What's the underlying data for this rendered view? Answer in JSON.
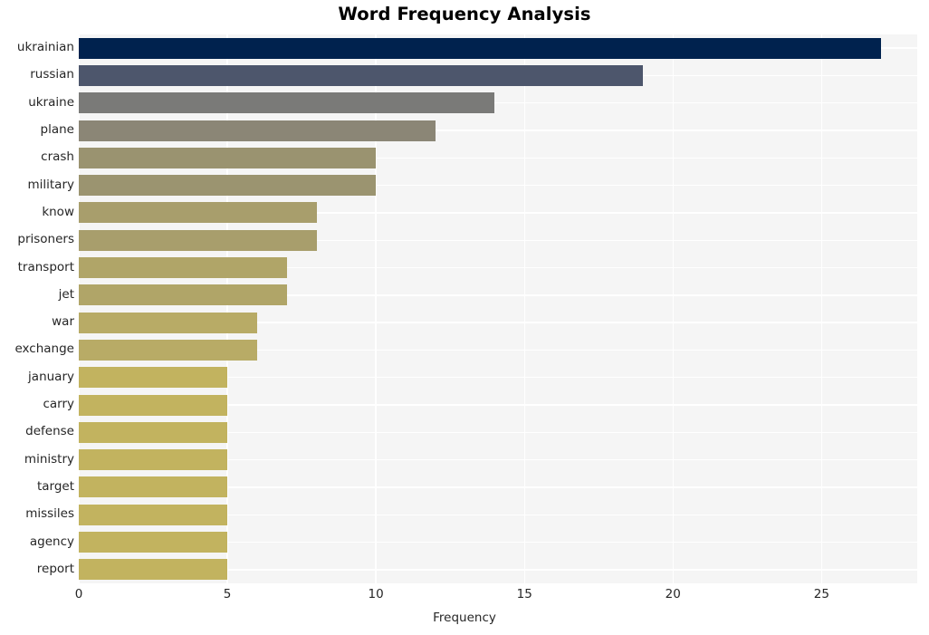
{
  "chart_data": {
    "type": "bar",
    "orientation": "horizontal",
    "title": "Word Frequency Analysis",
    "xlabel": "Frequency",
    "ylabel": "",
    "categories": [
      "ukrainian",
      "russian",
      "ukraine",
      "plane",
      "crash",
      "military",
      "know",
      "prisoners",
      "transport",
      "jet",
      "war",
      "exchange",
      "january",
      "carry",
      "defense",
      "ministry",
      "target",
      "missiles",
      "agency",
      "report"
    ],
    "values": [
      27,
      19,
      14,
      12,
      10,
      10,
      8,
      8,
      7,
      7,
      6,
      6,
      5,
      5,
      5,
      5,
      5,
      5,
      5,
      5
    ],
    "xticks": [
      0,
      5,
      10,
      15,
      20,
      25
    ],
    "xtick_labels": [
      "0",
      "5",
      "10",
      "15",
      "20",
      "25"
    ],
    "xlim": [
      0,
      28.22
    ],
    "grid": true,
    "legend": "none",
    "bar_colors": [
      "#00224e",
      "#4d566c",
      "#7a7a78",
      "#8b8676",
      "#9a9370",
      "#9b9470",
      "#a89e6c",
      "#a89e6c",
      "#b0a568",
      "#b0a568",
      "#b8ab66",
      "#b8ab66",
      "#c2b35f",
      "#c2b35f",
      "#c2b35f",
      "#c2b35f",
      "#c2b35f",
      "#c2b35f",
      "#c2b35f",
      "#c2b35f"
    ],
    "colormap": "cividis",
    "style": {
      "plot_background": "#f5f5f5",
      "figure_background": "#ffffff",
      "grid_color": "#ffffff",
      "text_color": "#262626",
      "title_color": "#000000"
    }
  }
}
